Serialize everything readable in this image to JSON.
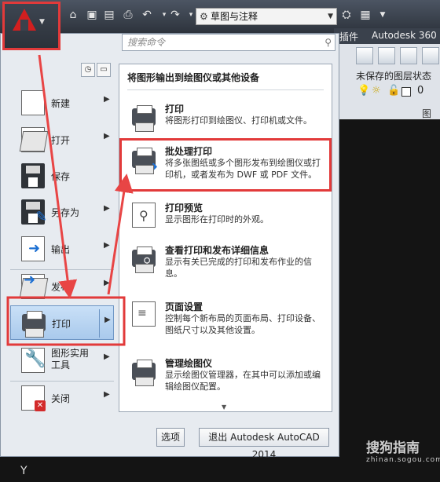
{
  "workspace": {
    "name": "草图与注释"
  },
  "ribbon": {
    "tab_plugin": "插件",
    "tab_a360": "Autodesk 360",
    "layer_state": "未保存的图层状态",
    "layer_value": "0",
    "panel_label": "图层"
  },
  "menu": {
    "search_placeholder": "搜索命令",
    "left_items": [
      {
        "label": "新建"
      },
      {
        "label": "打开"
      },
      {
        "label": "保存"
      },
      {
        "label": "另存为"
      },
      {
        "label": "输出"
      },
      {
        "label": "发布"
      },
      {
        "label": "打印"
      },
      {
        "label": "图形实用工具"
      },
      {
        "label": "关闭"
      }
    ],
    "submenu": {
      "title": "将图形输出到绘图仪或其他设备",
      "items": [
        {
          "title": "打印",
          "desc": "将图形打印到绘图仪、打印机或文件。"
        },
        {
          "title": "批处理打印",
          "desc": "将多张图纸或多个图形发布到绘图仪或打印机，或者发布为 DWF 或 PDF 文件。"
        },
        {
          "title": "打印预览",
          "desc": "显示图形在打印时的外观。"
        },
        {
          "title": "查看打印和发布详细信息",
          "desc": "显示有关已完成的打印和发布作业的信息。"
        },
        {
          "title": "页面设置",
          "desc": "控制每个新布局的页面布局、打印设备、图纸尺寸以及其他设置。"
        },
        {
          "title": "管理绘图仪",
          "desc": "显示绘图仪管理器，在其中可以添加或编辑绘图仪配置。"
        }
      ]
    },
    "options_label": "选项",
    "exit_label": "退出 Autodesk AutoCAD 2014"
  },
  "watermark": {
    "text": "搜狗指南",
    "url": "zhinan.sogou.com"
  },
  "colors": {
    "highlight_frame": "#e23a3a",
    "annotation_arrow": "#e84545",
    "hover_fill": "#b9d5f2"
  }
}
